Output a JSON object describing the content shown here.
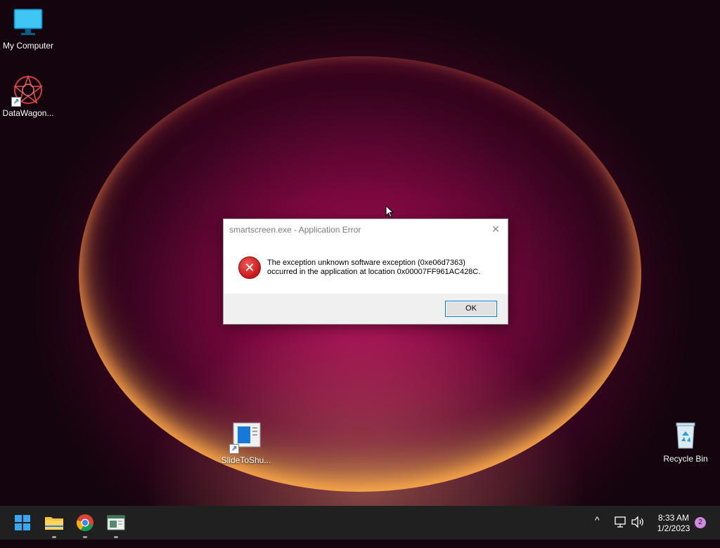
{
  "desktop": {
    "icons": [
      {
        "label": "My Computer"
      },
      {
        "label": "DataWagon..."
      },
      {
        "label": "SlideToShu..."
      },
      {
        "label": "Recycle Bin"
      }
    ]
  },
  "dialog": {
    "title": "smartscreen.exe - Application Error",
    "message_line1": "The exception unknown software exception (0xe06d7363)",
    "message_line2": "occurred in the application at location 0x00007FF961AC428C.",
    "ok_label": "OK",
    "close_glyph": "✕",
    "error_glyph": "✕"
  },
  "taskbar": {
    "apps": [
      "start-icon",
      "file-explorer-icon",
      "chrome-icon",
      "app-icon"
    ],
    "tray": {
      "chevron_glyph": "^",
      "time": "8:33 AM",
      "date": "1/2/2023",
      "notification_count": "2"
    }
  },
  "colors": {
    "taskbar": "#202020",
    "accent": "#0078d7",
    "error_red": "#c51717"
  }
}
